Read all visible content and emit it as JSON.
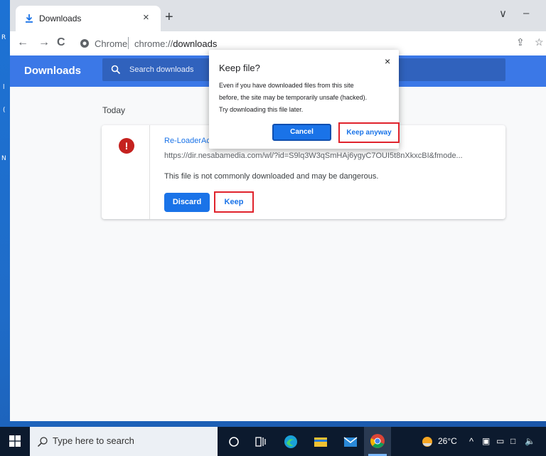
{
  "desktop": {
    "left_letters": [
      "R",
      "l",
      "(",
      "N"
    ]
  },
  "browser": {
    "tab": {
      "title": "Downloads",
      "close": "×"
    },
    "new_tab": "+",
    "window_controls": {
      "minimize": "–",
      "restore": "∨"
    },
    "nav": {
      "back": "←",
      "forward": "→",
      "reload": "C"
    },
    "omnibox": {
      "origin_label": "Chrome",
      "url_scheme": "chrome://",
      "url_host": "downloads"
    }
  },
  "downloads": {
    "title": "Downloads",
    "search_placeholder": "Search downloads",
    "section_label": "Today",
    "item": {
      "file_name": "Re-LoaderAc",
      "url": "https://dir.nesabamedia.com/wl/?id=S9lq3W3qSmHAj6ygyC7OUI5t8nXkxcBI&fmode...",
      "warning": "This file is not commonly downloaded and may be dangerous.",
      "discard_label": "Discard",
      "keep_label": "Keep",
      "status_glyph": "!"
    }
  },
  "dialog": {
    "title": "Keep file?",
    "close": "×",
    "body_lines": [
      "Even if you have downloaded files from this site",
      "before, the site may be temporarily unsafe (hacked).",
      "Try downloading this file later."
    ],
    "cancel_label": "Cancel",
    "keep_anyway_label": "Keep anyway"
  },
  "taskbar": {
    "search_text": "Type here to search",
    "temperature": "26°C",
    "tray_up": "^"
  },
  "colors": {
    "accent": "#1a73e8",
    "header_blue": "#3b78e7",
    "danger": "#c5221f",
    "highlight_red": "#e0232c"
  }
}
